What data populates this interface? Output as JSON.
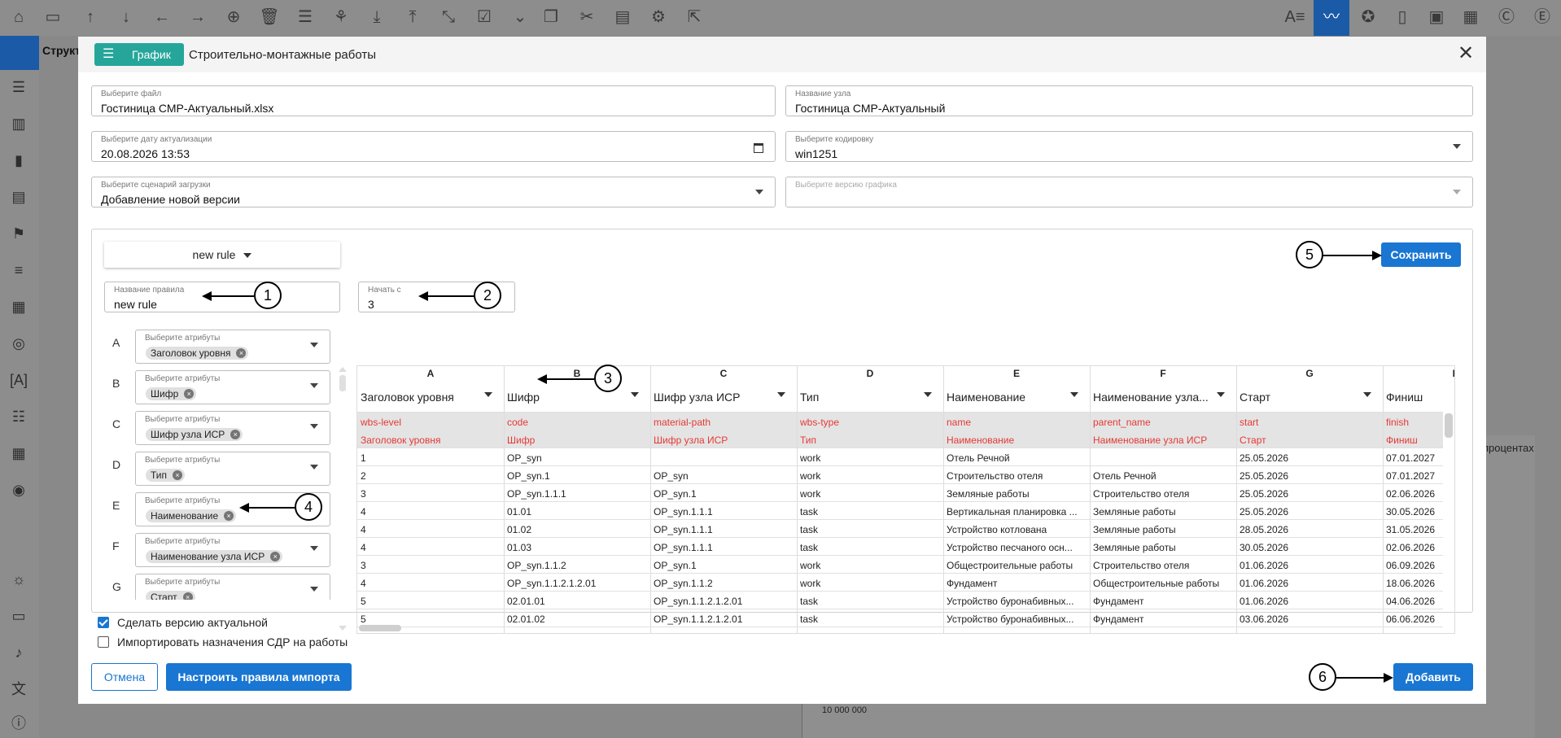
{
  "background": {
    "tab_title": "Структ",
    "right_label": "процентах",
    "chart_tick": "10 000 000"
  },
  "modal": {
    "badge_label": "График",
    "title": "Строительно-монтажные работы",
    "fields": {
      "file": {
        "label": "Выберите файл",
        "value": "Гостиница СМР-Актуальный.xlsx"
      },
      "node_name": {
        "label": "Название узла",
        "value": "Гостиница СМР-Актуальный"
      },
      "date": {
        "label": "Выберите дату актуализации",
        "value": "20.08.2026 13:53"
      },
      "encoding": {
        "label": "Выберите кодировку",
        "value": "win1251"
      },
      "scenario": {
        "label": "Выберите сценарий загрузки",
        "value": "Добавление новой версии"
      },
      "version": {
        "label": "Выберите версию графика",
        "value": ""
      }
    },
    "rule_selector": "new rule",
    "rule_name": {
      "label": "Название правила",
      "value": "new rule"
    },
    "start_from": {
      "label": "Начать с",
      "value": "3"
    },
    "save_label": "Сохранить",
    "attributes": [
      {
        "letter": "A",
        "label": "Выберите атрибуты",
        "chip": "Заголовок уровня"
      },
      {
        "letter": "B",
        "label": "Выберите атрибуты",
        "chip": "Шифр"
      },
      {
        "letter": "C",
        "label": "Выберите атрибуты",
        "chip": "Шифр узла ИСР"
      },
      {
        "letter": "D",
        "label": "Выберите атрибуты",
        "chip": "Тип"
      },
      {
        "letter": "E",
        "label": "Выберите атрибуты",
        "chip": "Наименование"
      },
      {
        "letter": "F",
        "label": "Выберите атрибуты",
        "chip": "Наименование узла ИСР"
      },
      {
        "letter": "G",
        "label": "Выберите атрибуты",
        "chip": "Старт"
      }
    ],
    "grid": {
      "letters": [
        "A",
        "B",
        "C",
        "D",
        "E",
        "F",
        "G",
        "H"
      ],
      "headers": [
        "Заголовок уровня",
        "Шифр",
        "Шифр узла ИСР",
        "Тип",
        "Наименование",
        "Наименование узла...",
        "Старт",
        "Финиш"
      ],
      "keys": [
        "wbs-level",
        "code",
        "material-path",
        "wbs-type",
        "name",
        "parent_name",
        "start",
        "finish"
      ],
      "key_labels": [
        "Заголовок уровня",
        "Шифр",
        "Шифр узла ИСР",
        "Тип",
        "Наименование",
        "Наименование узла ИСР",
        "Старт",
        "Финиш"
      ],
      "rows": [
        [
          "1",
          "OP_syn",
          "",
          "work",
          "Отель Речной",
          "",
          "25.05.2026",
          "07.01.2027"
        ],
        [
          "2",
          "OP_syn.1",
          "OP_syn",
          "work",
          "Строительство отеля",
          "Отель Речной",
          "25.05.2026",
          "07.01.2027"
        ],
        [
          "3",
          "OP_syn.1.1.1",
          "OP_syn.1",
          "work",
          "Земляные работы",
          "Строительство отеля",
          "25.05.2026",
          "02.06.2026"
        ],
        [
          "4",
          "01.01",
          "OP_syn.1.1.1",
          "task",
          "Вертикальная планировка ...",
          "Земляные работы",
          "25.05.2026",
          "30.05.2026"
        ],
        [
          "4",
          "01.02",
          "OP_syn.1.1.1",
          "task",
          "Устройство котлована",
          "Земляные работы",
          "28.05.2026",
          "31.05.2026"
        ],
        [
          "4",
          "01.03",
          "OP_syn.1.1.1",
          "task",
          "Устройство песчаного осн...",
          "Земляные работы",
          "30.05.2026",
          "02.06.2026"
        ],
        [
          "3",
          "OP_syn.1.1.2",
          "OP_syn.1",
          "work",
          "Общестроительные работы",
          "Строительство отеля",
          "01.06.2026",
          "06.09.2026"
        ],
        [
          "4",
          "OP_syn.1.1.2.1.2.01",
          "OP_syn.1.1.2",
          "work",
          "Фундамент",
          "Общестроительные работы",
          "01.06.2026",
          "18.06.2026"
        ],
        [
          "5",
          "02.01.01",
          "OP_syn.1.1.2.1.2.01",
          "task",
          "Устройство буронабивных...",
          "Фундамент",
          "01.06.2026",
          "04.06.2026"
        ],
        [
          "5",
          "02.01.02",
          "OP_syn.1.1.2.1.2.01",
          "task",
          "Устройство буронабивных...",
          "Фундамент",
          "03.06.2026",
          "06.06.2026"
        ]
      ]
    },
    "checkbox_actual": {
      "label": "Сделать версию актуальной",
      "checked": true
    },
    "checkbox_import": {
      "label": "Импортировать назначения СДР на работы",
      "checked": false
    },
    "cancel_label": "Отмена",
    "configure_label": "Настроить правила импорта",
    "add_label": "Добавить",
    "callouts": [
      "1",
      "2",
      "3",
      "4",
      "5",
      "6"
    ]
  },
  "colors": {
    "accent": "#1976d2",
    "badge": "#26a69a",
    "key_text": "#e53935"
  }
}
